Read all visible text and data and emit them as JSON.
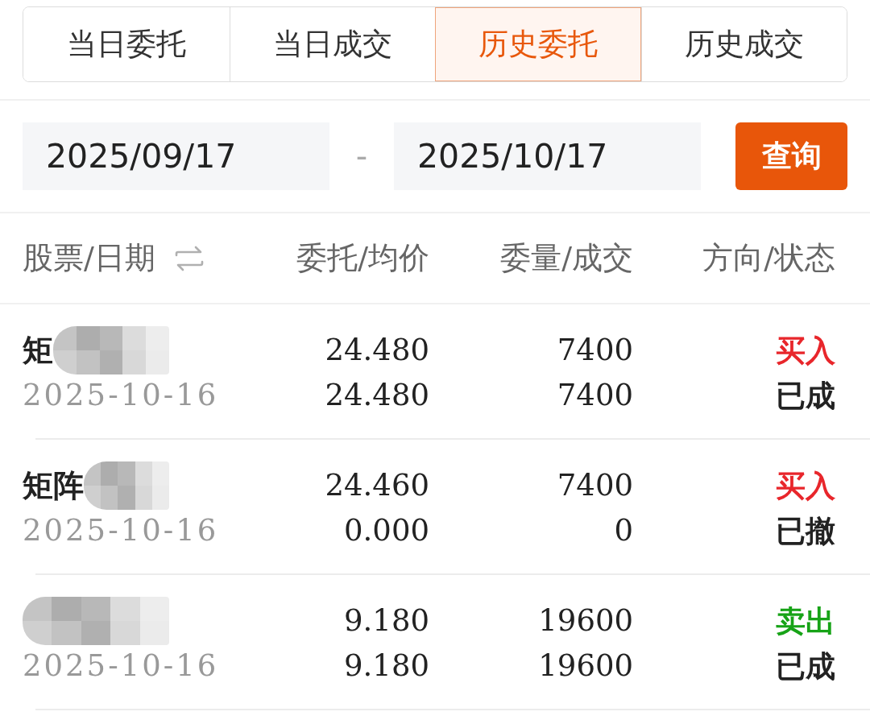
{
  "tabs": [
    {
      "label": "当日委托",
      "selected": false
    },
    {
      "label": "当日成交",
      "selected": false
    },
    {
      "label": "历史委托",
      "selected": true
    },
    {
      "label": "历史成交",
      "selected": false
    }
  ],
  "date_range": {
    "start": "2025/09/17",
    "separator": "-",
    "end": "2025/10/17",
    "query_button": "查询"
  },
  "table": {
    "columns": [
      {
        "label": "股票/日期",
        "sortable": true
      },
      {
        "label": "委托/均价",
        "sortable": false
      },
      {
        "label": "委量/成交",
        "sortable": false
      },
      {
        "label": "方向/状态",
        "sortable": false
      }
    ],
    "rows": [
      {
        "name": "矩",
        "redacted": true,
        "date": "2025-10-16",
        "price": "24.480",
        "avg_price": "24.480",
        "quantity": "7400",
        "filled": "7400",
        "direction": {
          "label": "买入",
          "color": "#e8262b"
        },
        "status": "已成"
      },
      {
        "name": "矩阵",
        "redacted": true,
        "date": "2025-10-16",
        "price": "24.460",
        "avg_price": "0.000",
        "quantity": "7400",
        "filled": "0",
        "direction": {
          "label": "买入",
          "color": "#e8262b"
        },
        "status": "已撤"
      },
      {
        "redacted": true,
        "date": "2025-10-16",
        "price": "9.180",
        "avg_price": "9.180",
        "quantity": "19600",
        "filled": "19600",
        "direction": {
          "label": "卖出",
          "color": "#17a317"
        },
        "status": "已成"
      }
    ]
  }
}
